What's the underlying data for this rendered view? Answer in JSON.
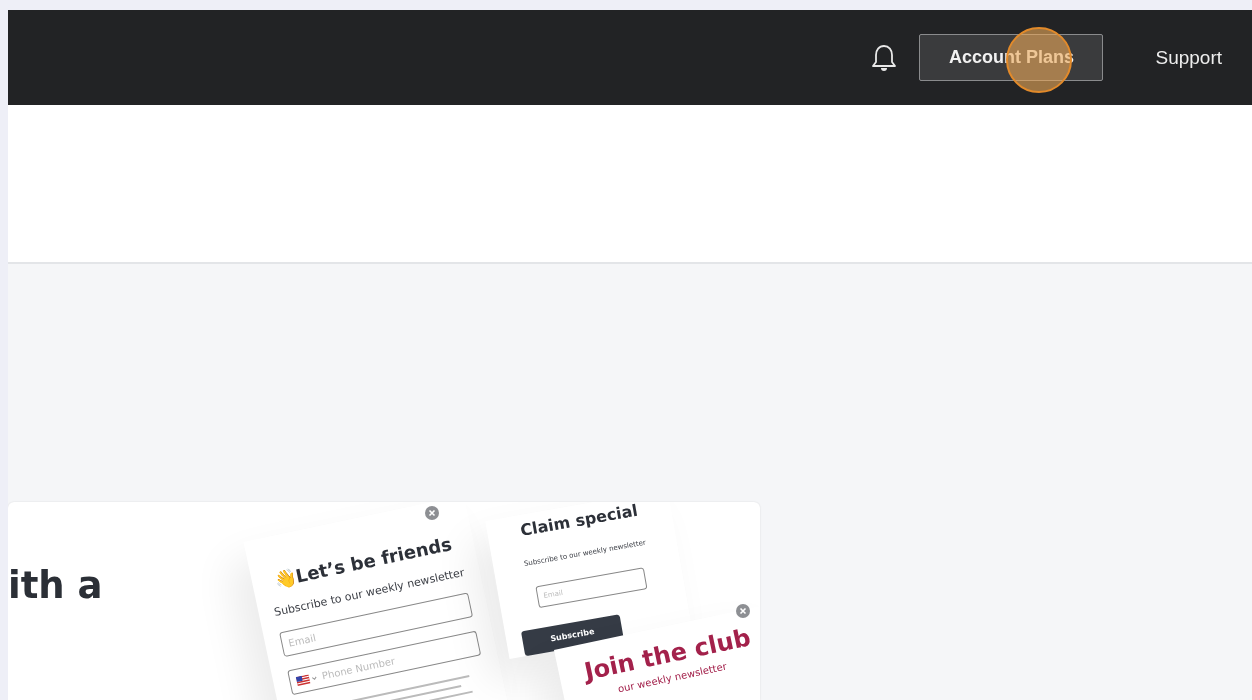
{
  "header": {
    "account_button": "Account Plans",
    "support_link": "Support",
    "click_marker": true
  },
  "card": {
    "heading": "ith a",
    "popups": [
      {
        "kind": "friends",
        "title": "Let’s be friends",
        "emoji": "👋",
        "subtitle": "Subscribe to our weekly newsletter",
        "fields": [
          "Email",
          "Phone Number"
        ]
      },
      {
        "kind": "claim",
        "title": "Claim special",
        "subtitle": "Subscribe to our weekly newsletter",
        "fields": [
          "Email"
        ],
        "button": "Subscribe"
      },
      {
        "kind": "club",
        "title": "Join the club",
        "subtitle": "our weekly newsletter"
      }
    ]
  }
}
